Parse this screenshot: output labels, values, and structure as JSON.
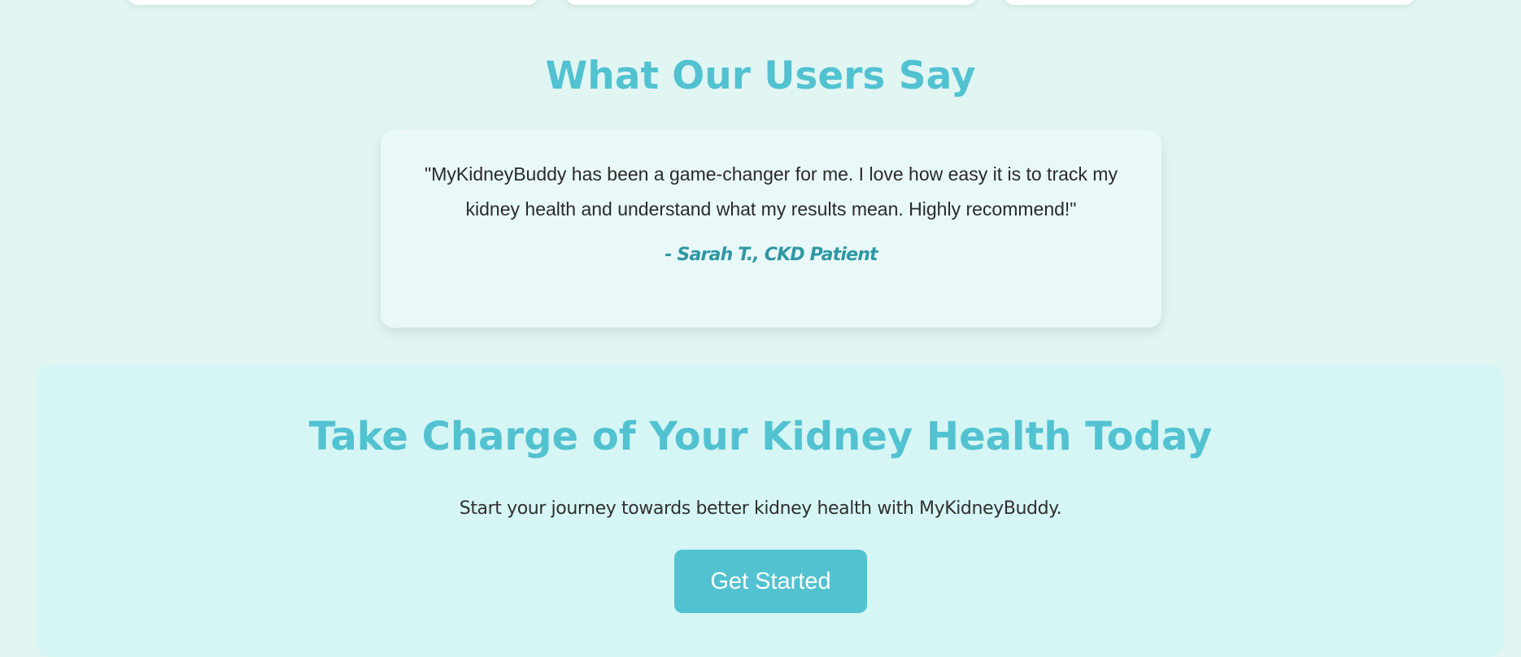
{
  "testimonials": {
    "title": "What Our Users Say",
    "quote": "\"MyKidneyBuddy has been a game-changer for me. I love how easy it is to track my kidney health and understand what my results mean. Highly recommend!\"",
    "author": "- Sarah T., CKD Patient"
  },
  "cta": {
    "title": "Take Charge of Your Kidney Health Today",
    "subtitle": "Start your journey towards better kidney health with MyKidneyBuddy.",
    "button_label": "Get Started"
  },
  "colors": {
    "accent": "#52c2d1",
    "page_background": "#e1f6f3",
    "cta_background": "#d5f6f4",
    "author_text": "#2f97a4"
  }
}
